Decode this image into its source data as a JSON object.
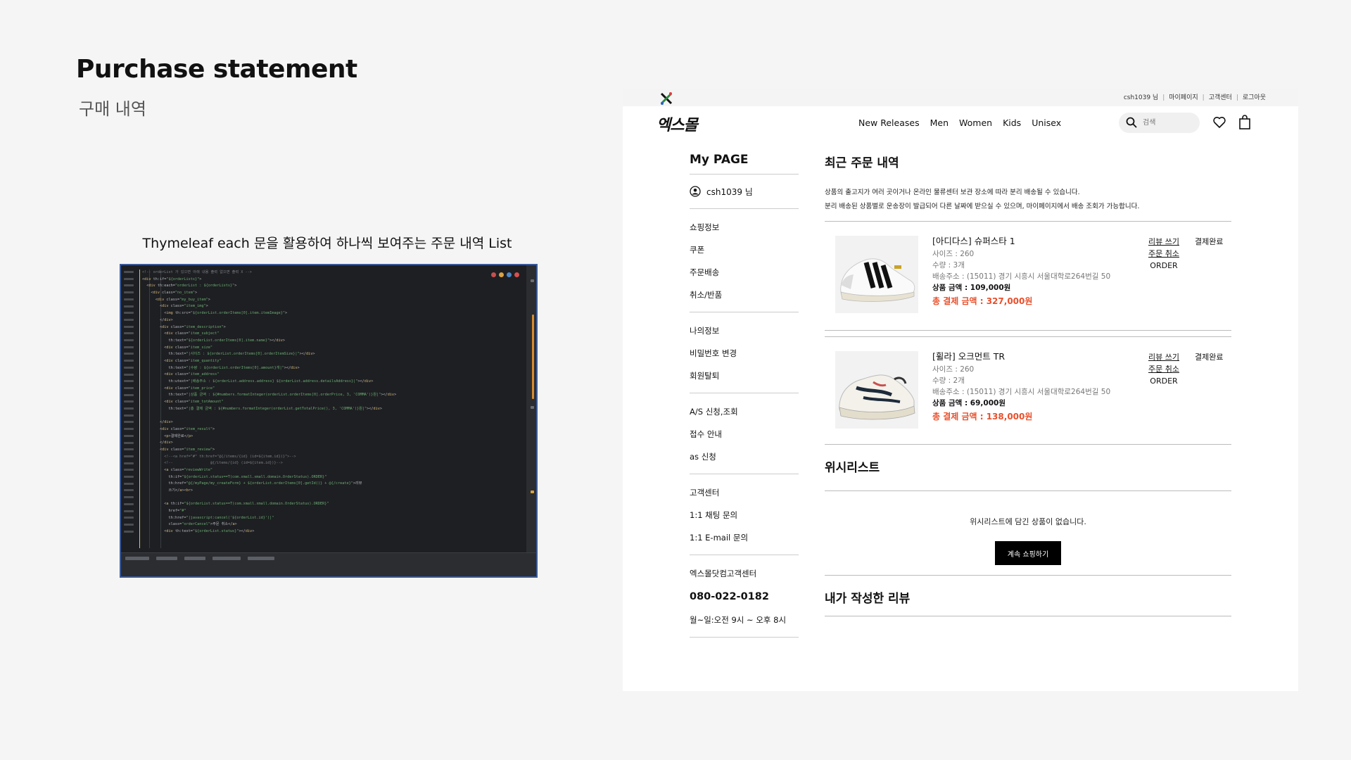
{
  "slide": {
    "title": "Purchase statement",
    "subtitle": "구매 내역",
    "code_caption": "Thymeleaf each 문을 활용하여 하나씩 보여주는 주문 내역 List"
  },
  "code_editor": {
    "lines": [
      "<!-- orderList 가 있으면 아래 내용 출력 없으면 출력 X -->",
      "<div th:if=\"${orderLists}\">",
      "  <div th:each=\"orderList : ${orderLists}\">",
      "    <div class=\"no_item\">",
      "      <div class=\"my_buy_item\">",
      "        <div class=\"item_img\">",
      "          <img th:src=\"${orderList.orderItems[0].item.itemImage}\">",
      "        </div>",
      "        <div class=\"item_description\">",
      "          <div class=\"item_subject\"",
      "            th:text=\"${orderList.orderItems[0].item.name}\"></div>",
      "          <div class=\"item_size\"",
      "            th:text=\"|사이즈 : ${orderList.orderItems[0].orderItemSize}|\"></div>",
      "          <div class=\"item_quantity\"",
      "            th:text=\"|수량 : ${orderList.orderItems[0].amount}개|\"></div>",
      "          <div class=\"item_address\"",
      "            th:utext=\"|배송주소 : ${orderList.address.address} ${orderList.address.detailsAddress}|\"></div>",
      "          <div class=\"item_price\"",
      "            th:text=\"|상품 금액 : ${#numbers.formatInteger(orderList.orderItems[0].orderPrice, 3, 'COMMA')}원|\"></div>",
      "          <div class=\"item_totAmount\"",
      "            th:text=\"|총 결제 금액 : ${#numbers.formatInteger(orderList.getTotalPrice(), 3, 'COMMA')}원|\"></div>",
      "",
      "        </div>",
      "        <div class=\"item_result\">",
      "          <p>결제완료</p>",
      "        </div>",
      "        <div class=\"item_review\">",
      "          <!--<a href=\"#\" th:href=\"@{/items/{id} (id=${item.id})}\">-->",
      "          <!--                 @{/items/{id} (id=${item.id})}-->",
      "          <a class=\"reviewWrite\"",
      "            th:if=\"${orderList.status==T(com.xmall.xmall.domain.OrderStatus).ORDER}\"",
      "            th:href=\"@{/myPage/my_createForm} + ${orderList.orderItems[0].getId()} + @{/create}\">리뷰",
      "            쓰기</a><br>",
      "",
      "          <a th:if=\"${orderList.status==T(com.xmall.xmall.domain.OrderStatus).ORDER}\"",
      "            href=\"#\"",
      "            th:href=\"|javascript:cancel('${orderList.id}')|\"",
      "            class=\"orderCancel\">주문 취소</a>",
      "          <div th:text=\"${orderList.status}\"></div>"
    ]
  },
  "site": {
    "topbar_links": [
      "csh1039 님",
      "마이페이지",
      "고객센터",
      "로그아웃"
    ],
    "brand": "엑스몰",
    "nav": [
      "New Releases",
      "Men",
      "Women",
      "Kids",
      "Unisex"
    ],
    "search_placeholder": "검색",
    "sidebar": {
      "title": "My PAGE",
      "user": "csh1039 님",
      "group1": [
        "쇼핑정보",
        "쿠폰",
        "주문배송",
        "취소/반품"
      ],
      "group2": [
        "나의정보",
        "비밀번호 변경",
        "회원탈퇴"
      ],
      "group3": [
        "A/S 신청,조회",
        "접수 안내",
        "as 신청"
      ],
      "group4": [
        "고객센터",
        "1:1 채팅 문의",
        "1:1 E-mail 문의"
      ],
      "center_title": "엑스몰닷컴고객센터",
      "phone": "080-022-0182",
      "hours": "월~일:오전 9시 ~ 오후 8시"
    },
    "main": {
      "recent_title": "최근 주문 내역",
      "notice1": "상품의 출고지가 여러 곳이거나 온라인 물류센터 보관 장소에 따라 분리 배송될 수 있습니다.",
      "notice2": "분리 배송된 상품별로 운송장이 발급되어 다른 날짜에 받으실 수 있으며, 마이페이지에서 배송 조회가 가능합니다.",
      "orders": [
        {
          "name": "[아디다스] 슈퍼스타 1",
          "size": "사이즈 : 260",
          "qty": "수량 : 3개",
          "address": "배송주소 : (15011) 경기 시흥시 서울대학로264번길 50",
          "price": "상품 금액 : 109,000원",
          "total": "총 결제 금액 : 327,000원",
          "review": "리뷰 쓰기",
          "cancel": "주문 취소",
          "state": "ORDER",
          "status": "결제완료"
        },
        {
          "name": "[휠라] 오크먼트 TR",
          "size": "사이즈 : 260",
          "qty": "수량 : 2개",
          "address": "배송주소 : (15011) 경기 시흥시 서울대학로264번길 50",
          "price": "상품 금액 : 69,000원",
          "total": "총 결제 금액 : 138,000원",
          "review": "리뷰 쓰기",
          "cancel": "주문 취소",
          "state": "ORDER",
          "status": "결제완료"
        }
      ],
      "wishlist_title": "위시리스트",
      "wishlist_empty": "위시리스트에 담긴 상품이 없습니다.",
      "wishlist_button": "계속 쇼핑하기",
      "review_title": "내가 작성한 리뷰"
    }
  }
}
